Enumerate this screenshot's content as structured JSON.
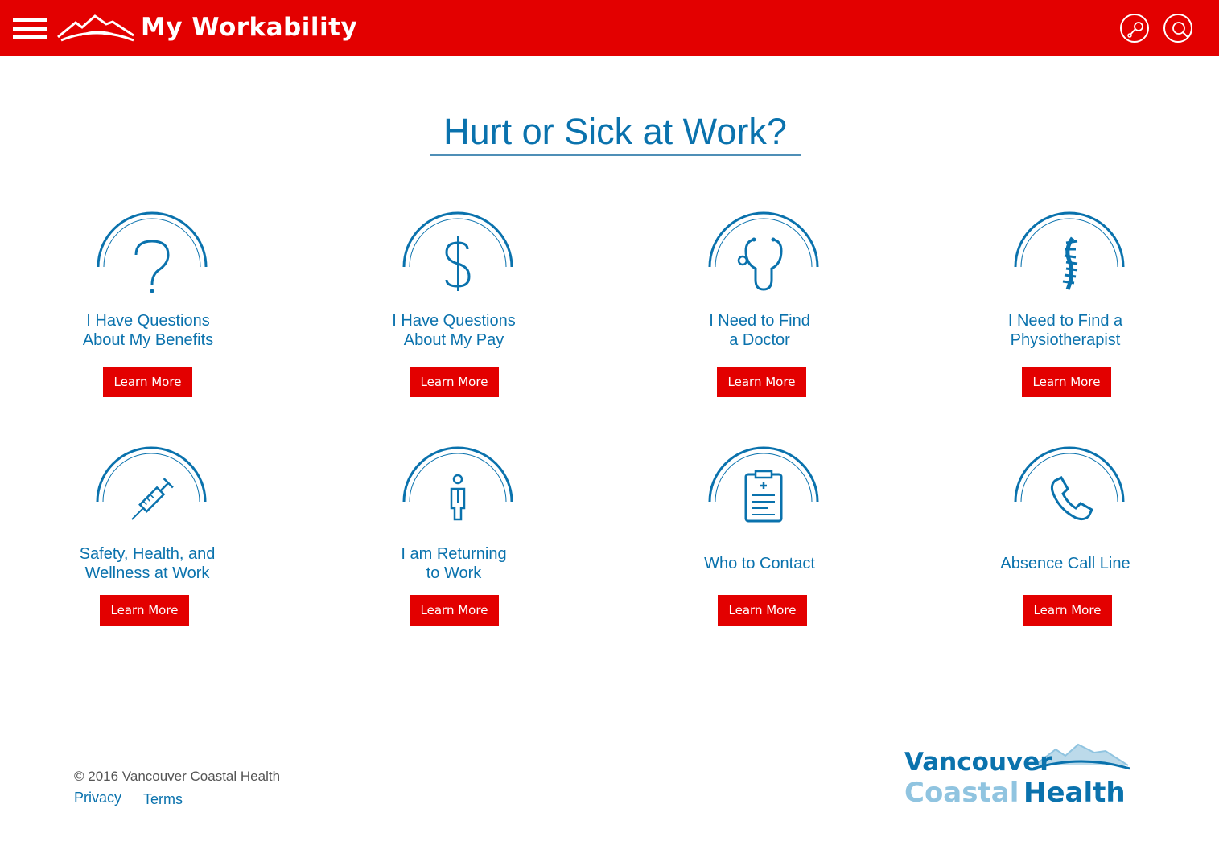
{
  "header": {
    "app_title": "My Workability",
    "icons": [
      "menu-icon",
      "mountain-logo",
      "profile-icon",
      "search-icon"
    ],
    "bg_color": "#e30000"
  },
  "main": {
    "title": "Hurt or Sick at Work?",
    "accent_color": "#0a72ad",
    "cards": [
      {
        "label": "I Have Questions\nAbout My Benefits",
        "icon": "question-icon",
        "button": "Learn More"
      },
      {
        "label": "I Have Questions\nAbout My Pay",
        "icon": "dollar-icon",
        "button": "Learn More"
      },
      {
        "label": "I Need to Find\na Doctor",
        "icon": "stethoscope-icon",
        "button": "Learn More"
      },
      {
        "label": "I Need to Find a\nPhysiotherapist",
        "icon": "spine-icon",
        "button": "Learn More"
      },
      {
        "label": "Safety, Health, and\nWellness at Work",
        "icon": "syringe-icon",
        "button": "Learn More"
      },
      {
        "label": "I am Returning\nto Work",
        "icon": "person-icon",
        "button": "Learn More"
      },
      {
        "label": "Who to Contact",
        "icon": "clipboard-icon",
        "button": "Learn More"
      },
      {
        "label": "Absence Call Line",
        "icon": "phone-icon",
        "button": "Learn More"
      }
    ]
  },
  "footer": {
    "copyright": "© 2016 Vancouver Coastal Health",
    "links": [
      "Privacy",
      "Terms"
    ],
    "logo_line1": "Vancouver",
    "logo_line2a": "Coastal",
    "logo_line2b": "Health"
  }
}
